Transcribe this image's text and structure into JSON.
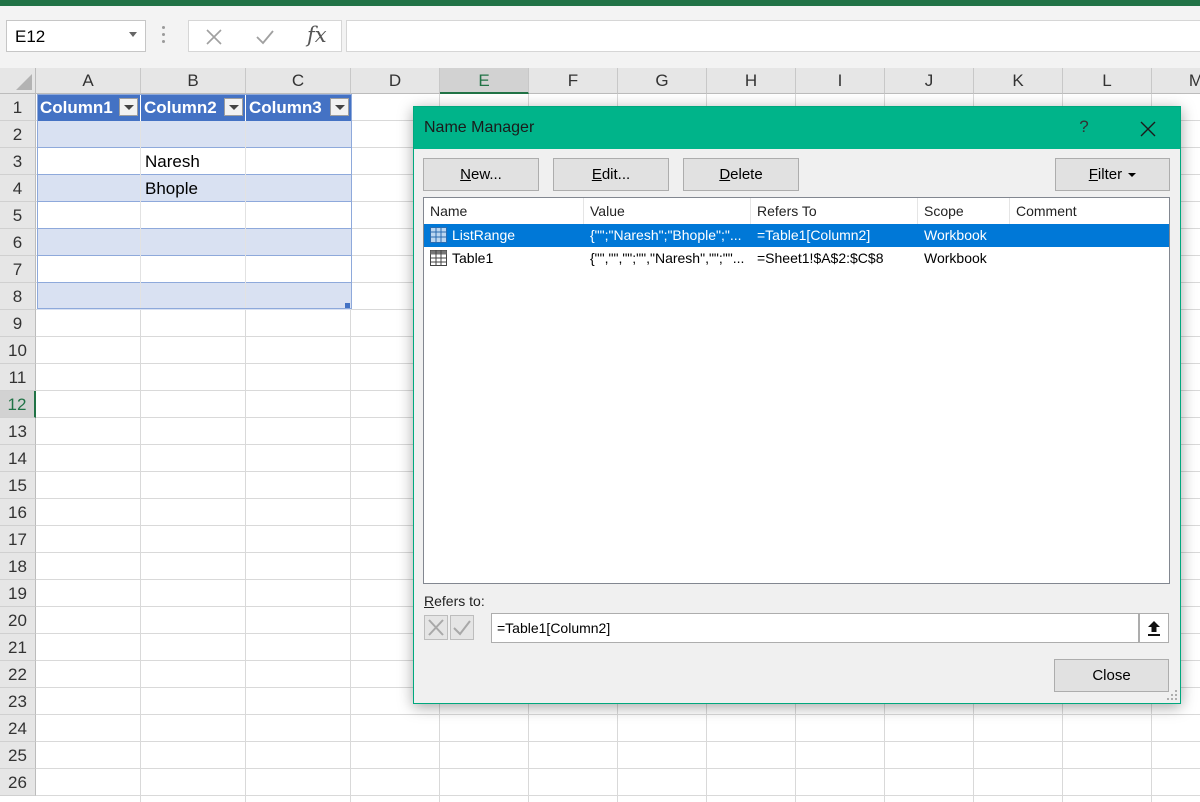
{
  "formula_bar": {
    "name_box": "E12",
    "cancel_icon": "x-icon",
    "enter_icon": "check-icon",
    "fx_label": "fx",
    "formula_value": ""
  },
  "sheet": {
    "columns": [
      "A",
      "B",
      "C",
      "D",
      "E",
      "F",
      "G",
      "H",
      "I",
      "J",
      "K",
      "L",
      "M"
    ],
    "active_column": "E",
    "rows": [
      "1",
      "2",
      "3",
      "4",
      "5",
      "6",
      "7",
      "8",
      "9",
      "10",
      "11",
      "12",
      "13",
      "14",
      "15",
      "16",
      "17",
      "18",
      "19",
      "20",
      "21",
      "22",
      "23",
      "24",
      "25",
      "26"
    ],
    "active_row": "12"
  },
  "table": {
    "headers": [
      "Column1",
      "Column2",
      "Column3"
    ],
    "cells": {
      "B3": "Naresh",
      "B4": "Bhople"
    }
  },
  "dialog": {
    "title": "Name Manager",
    "help": "?",
    "buttons": {
      "new_u": "N",
      "new_rest": "ew...",
      "edit_u": "E",
      "edit_rest": "dit...",
      "delete_u": "D",
      "delete_rest": "elete",
      "filter_u": "F",
      "filter_rest": "ilter"
    },
    "list_headers": [
      "Name",
      "Value",
      "Refers To",
      "Scope",
      "Comment"
    ],
    "rows": [
      {
        "name": "ListRange",
        "value": "{\"\";\"Naresh\";\"Bhople\";\"...",
        "refers_to": "=Table1[Column2]",
        "scope": "Workbook",
        "comment": "",
        "selected": true
      },
      {
        "name": "Table1",
        "value": "{\"\",\"\",\"\";\"\",\"Naresh\",\"\";\"\"...",
        "refers_to": "=Sheet1!$A$2:$C$8",
        "scope": "Workbook",
        "comment": "",
        "selected": false
      }
    ],
    "refers_to_label_u": "R",
    "refers_to_label_rest": "efers to:",
    "refers_to_value": "=Table1[Column2]",
    "close_label": "Close"
  },
  "colors": {
    "ribbon_green": "#217346",
    "dialog_title": "#00b48a",
    "table_header": "#4472c4",
    "table_band": "#d9e1f2",
    "selection": "#0078d7"
  }
}
